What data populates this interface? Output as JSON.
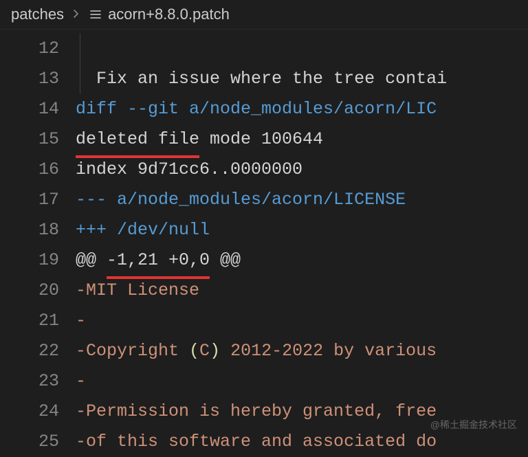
{
  "breadcrumb": {
    "folder": "patches",
    "file": "acorn+8.8.0.patch"
  },
  "lines": [
    {
      "num": "12",
      "indent": true,
      "segs": []
    },
    {
      "num": "13",
      "indent": true,
      "segs": [
        {
          "cls": "tok-plain",
          "t": "  Fix an issue where the tree contai"
        }
      ]
    },
    {
      "num": "14",
      "indent": false,
      "segs": [
        {
          "cls": "tok-blue",
          "t": "diff --git a/node_modules/acorn/LIC"
        }
      ]
    },
    {
      "num": "15",
      "indent": false,
      "segs": [
        {
          "cls": "tok-plain underline-red",
          "t": "deleted file"
        },
        {
          "cls": "tok-plain",
          "t": " mode 100644"
        }
      ]
    },
    {
      "num": "16",
      "indent": false,
      "segs": [
        {
          "cls": "tok-plain",
          "t": "index 9d71cc6..0000000"
        }
      ]
    },
    {
      "num": "17",
      "indent": false,
      "segs": [
        {
          "cls": "tok-blue",
          "t": "--- a/node_modules/acorn/LICENSE"
        }
      ]
    },
    {
      "num": "18",
      "indent": false,
      "segs": [
        {
          "cls": "tok-blue",
          "t": "+++ /dev/null"
        }
      ]
    },
    {
      "num": "19",
      "indent": false,
      "segs": [
        {
          "cls": "tok-plain",
          "t": "@@ "
        },
        {
          "cls": "tok-plain underline-red",
          "t": "-1,21 +0,0"
        },
        {
          "cls": "tok-plain",
          "t": " @@"
        }
      ]
    },
    {
      "num": "20",
      "indent": false,
      "segs": [
        {
          "cls": "tok-red",
          "t": "-MIT License"
        }
      ]
    },
    {
      "num": "21",
      "indent": false,
      "segs": [
        {
          "cls": "tok-red",
          "t": "-"
        }
      ]
    },
    {
      "num": "22",
      "indent": false,
      "segs": [
        {
          "cls": "tok-red",
          "t": "-Copyright "
        },
        {
          "cls": "tok-yellow",
          "t": "("
        },
        {
          "cls": "tok-red",
          "t": "C"
        },
        {
          "cls": "tok-yellow",
          "t": ")"
        },
        {
          "cls": "tok-red",
          "t": " 2012-2022 by various"
        }
      ]
    },
    {
      "num": "23",
      "indent": false,
      "segs": [
        {
          "cls": "tok-red",
          "t": "-"
        }
      ]
    },
    {
      "num": "24",
      "indent": false,
      "segs": [
        {
          "cls": "tok-red",
          "t": "-Permission is hereby granted, free"
        }
      ]
    },
    {
      "num": "25",
      "indent": false,
      "segs": [
        {
          "cls": "tok-red",
          "t": "-of this software and associated do"
        }
      ]
    }
  ],
  "watermark": "@稀土掘金技术社区"
}
